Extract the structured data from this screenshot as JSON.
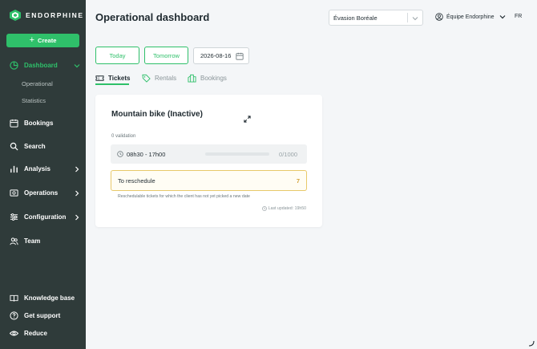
{
  "app": {
    "brand": "ENDORPHINE",
    "accent": "#2fc06a",
    "sidebar_bg": "#2f3b3a"
  },
  "sidebar": {
    "create_label": "Create",
    "dashboard_label": "Dashboard",
    "sub_operational": "Operational",
    "sub_statistics": "Statistics",
    "bookings_label": "Bookings",
    "search_label": "Search",
    "analysis_label": "Analysis",
    "operations_label": "Operations",
    "configuration_label": "Configuration",
    "team_label": "Team",
    "knowledge_label": "Knowledge base",
    "support_label": "Get support",
    "reduce_label": "Reduce"
  },
  "header": {
    "title": "Operational dashboard",
    "site_select": "Évasion Boréale",
    "team": "Équipe Endorphine",
    "lang": "FR"
  },
  "dates": {
    "today": "Today",
    "tomorrow": "Tomorrow",
    "date": "2026-08-16"
  },
  "tabs": {
    "tickets": "Tickets",
    "rentals": "Rentals",
    "bookings": "Bookings"
  },
  "card": {
    "title": "Mountain bike (Inactive)",
    "validation": "0 validation",
    "slot_time": "08h30 - 17h00",
    "slot_count": "0/1000",
    "slot_fill": 0,
    "reschedule_label": "To reschedule",
    "reschedule_count": "7",
    "reschedule_desc": "Reschedulable tickets for which the client has not yet picked a new date",
    "last_updated": "Last updated: 19h50"
  }
}
